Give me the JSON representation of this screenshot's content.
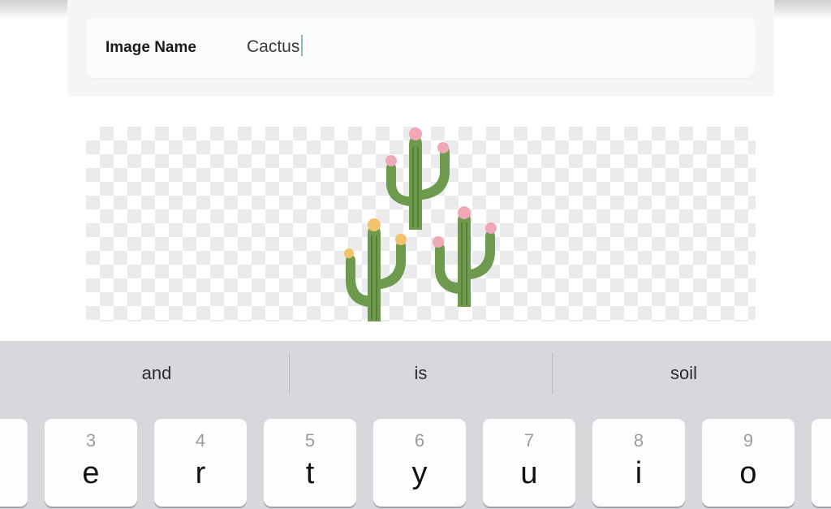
{
  "form": {
    "image_name_label": "Image Name",
    "image_name_value": "Cactus"
  },
  "preview": {
    "icon": "cactus-trio-illustration",
    "colors": {
      "cactus_green": "#6e9a4e",
      "flower_pink": "#f0a8b4",
      "flower_yellow": "#f2c36a"
    }
  },
  "keyboard": {
    "suggestions": [
      "and",
      "is",
      "soil"
    ],
    "keys": [
      {
        "num": "",
        "letter": ""
      },
      {
        "num": "3",
        "letter": "e"
      },
      {
        "num": "4",
        "letter": "r"
      },
      {
        "num": "5",
        "letter": "t"
      },
      {
        "num": "6",
        "letter": "y"
      },
      {
        "num": "7",
        "letter": "u"
      },
      {
        "num": "8",
        "letter": "i"
      },
      {
        "num": "9",
        "letter": "o"
      },
      {
        "num": "",
        "letter": ""
      }
    ]
  }
}
